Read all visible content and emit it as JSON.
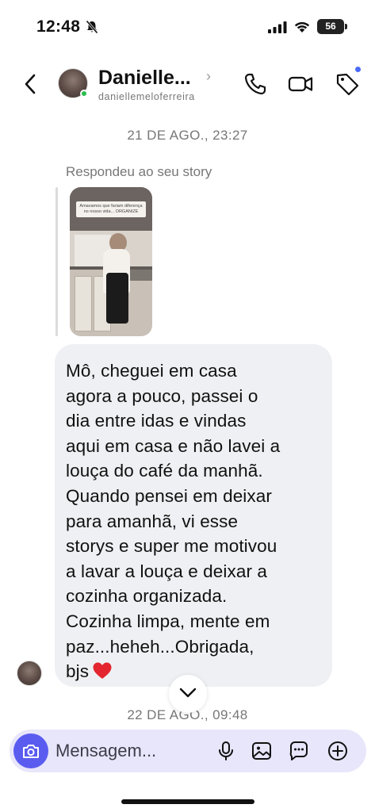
{
  "status_bar": {
    "time": "12:48",
    "battery": "56"
  },
  "header": {
    "contact_name": "Danielle...",
    "contact_handle": "daniellemeloferreira"
  },
  "conversation": {
    "timestamp_1": "21 DE AGO., 23:27",
    "replied_label": "Respondeu ao seu story",
    "story_caption": "Amavamos que fariam diferença no nosso vida... ORGANIZE",
    "message_text": "Mô, cheguei em casa\nagora a pouco, passei o\ndia entre idas e vindas\naqui em casa e não lavei a\nlouça do café da manhã.\nQuando pensei em deixar\npara amanhã,  vi esse\nstorys e super me motivou\na lavar a louça e deixar a\ncozinha organizada.\nCozinha limpa, mente em\npaz...heheh...Obrigada,\nbjs",
    "timestamp_2": "22 DE AGO., 09:48"
  },
  "composer": {
    "placeholder": "Mensagem..."
  },
  "colors": {
    "accent": "#5a5cf0",
    "composer_bg": "#e7e6fb",
    "bubble_bg": "#eff0f3",
    "heart": "#e3262f"
  },
  "icons": [
    "bell-off-icon",
    "signal-icon",
    "wifi-icon",
    "battery-icon",
    "back-icon",
    "phone-icon",
    "video-icon",
    "tag-icon",
    "heart-icon",
    "chevron-down-icon",
    "camera-icon",
    "mic-icon",
    "gallery-icon",
    "sticker-icon",
    "plus-icon"
  ]
}
